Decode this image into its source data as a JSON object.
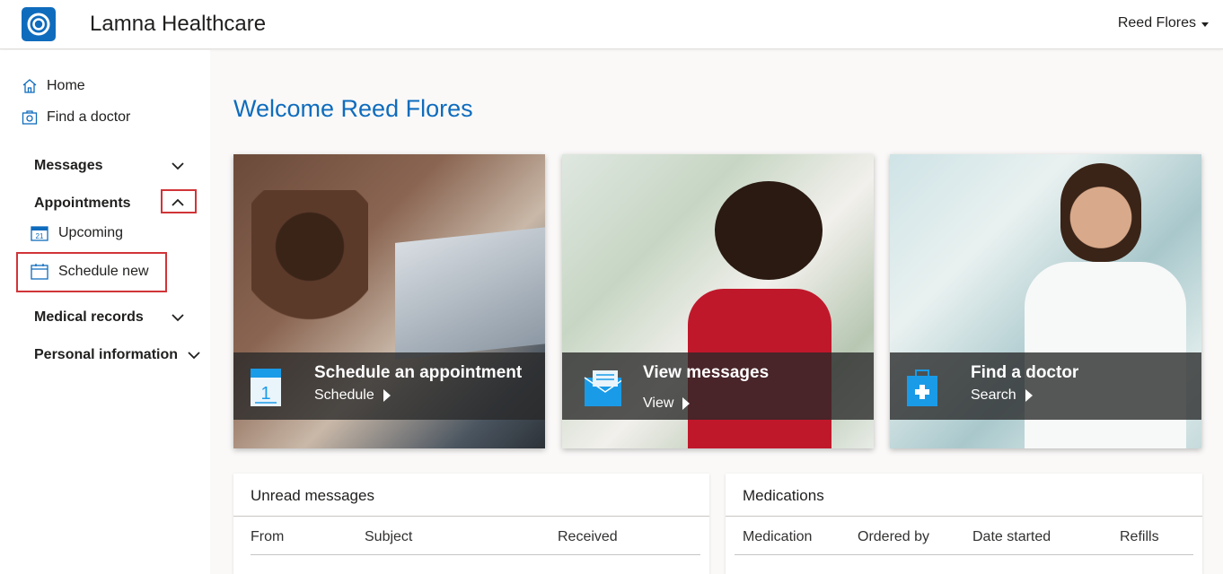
{
  "app": {
    "title": "Lamna Healthcare"
  },
  "user": {
    "name": "Reed Flores"
  },
  "sidebar": {
    "home": "Home",
    "find_doctor": "Find a doctor",
    "sections": {
      "messages": "Messages",
      "appointments": "Appointments",
      "medical_records": "Medical records",
      "personal_information": "Personal information"
    },
    "appointments_items": {
      "upcoming": "Upcoming",
      "schedule_new": "Schedule new",
      "calendar_date": "21"
    }
  },
  "main": {
    "welcome": "Welcome Reed Flores",
    "cards": [
      {
        "title": "Schedule an appointment",
        "action": "Schedule",
        "icon": "calendar-icon",
        "icon_text": "1"
      },
      {
        "title": "View messages",
        "action": "View",
        "icon": "envelope-icon"
      },
      {
        "title": "Find a doctor",
        "action": "Search",
        "icon": "medical-kit-icon"
      }
    ],
    "unread_messages": {
      "title": "Unread messages",
      "columns": [
        "From",
        "Subject",
        "Received"
      ]
    },
    "medications": {
      "title": "Medications",
      "columns": [
        "Medication",
        "Ordered by",
        "Date started",
        "Refills"
      ]
    }
  },
  "colors": {
    "accent": "#0f6cbd",
    "highlight": "#d13438",
    "icon_blue": "#1a9be8"
  }
}
